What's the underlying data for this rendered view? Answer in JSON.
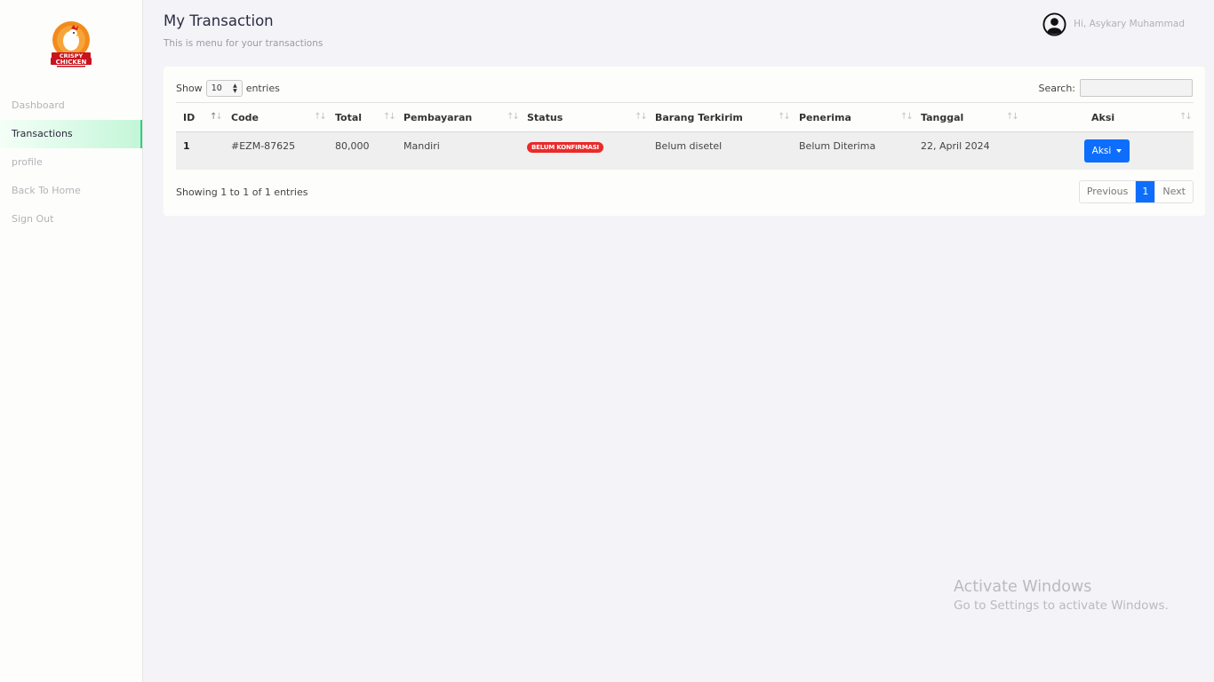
{
  "brand": {
    "logo_text_top": "CRISPY",
    "logo_text_bottom": "CHICKEN",
    "logo_colors": {
      "circle": "#f28b1c",
      "text": "#c8141e"
    }
  },
  "sidebar": {
    "items": [
      {
        "label": "Dashboard",
        "active": false
      },
      {
        "label": "Transactions",
        "active": true
      },
      {
        "label": "profile",
        "active": false
      },
      {
        "label": "Back To Home",
        "active": false
      },
      {
        "label": "Sign Out",
        "active": false
      }
    ]
  },
  "header": {
    "title": "My Transaction",
    "subtitle": "This is menu for your transactions",
    "user_greeting": "Hi, Asykary Muhammad",
    "user_icon": "user-circle-icon"
  },
  "table_controls": {
    "show_label": "Show",
    "page_length": "10",
    "entries_label": "entries",
    "search_label": "Search:",
    "search_value": ""
  },
  "table": {
    "columns": [
      "ID",
      "Code",
      "Total",
      "Pembayaran",
      "Status",
      "Barang Terkirim",
      "Penerima",
      "Tanggal",
      "Aksi"
    ],
    "rows": [
      {
        "id": "1",
        "code": "#EZM-87625",
        "total": "80,000",
        "pembayaran": "Mandiri",
        "status": "BELUM KONFIRMASI",
        "barang_terkirim": "Belum disetel",
        "penerima": "Belum Diterima",
        "tanggal": "22, April 2024",
        "aksi_label": "Aksi"
      }
    ]
  },
  "footer": {
    "info": "Showing 1 to 1 of 1 entries",
    "pagination": {
      "previous": "Previous",
      "current": "1",
      "next": "Next"
    }
  },
  "colors": {
    "primary": "#0d6efd",
    "badge_danger": "#ea2a2a",
    "active_accent": "#2ed47a"
  },
  "watermark": {
    "title": "Activate Windows",
    "subtitle": "Go to Settings to activate Windows."
  }
}
